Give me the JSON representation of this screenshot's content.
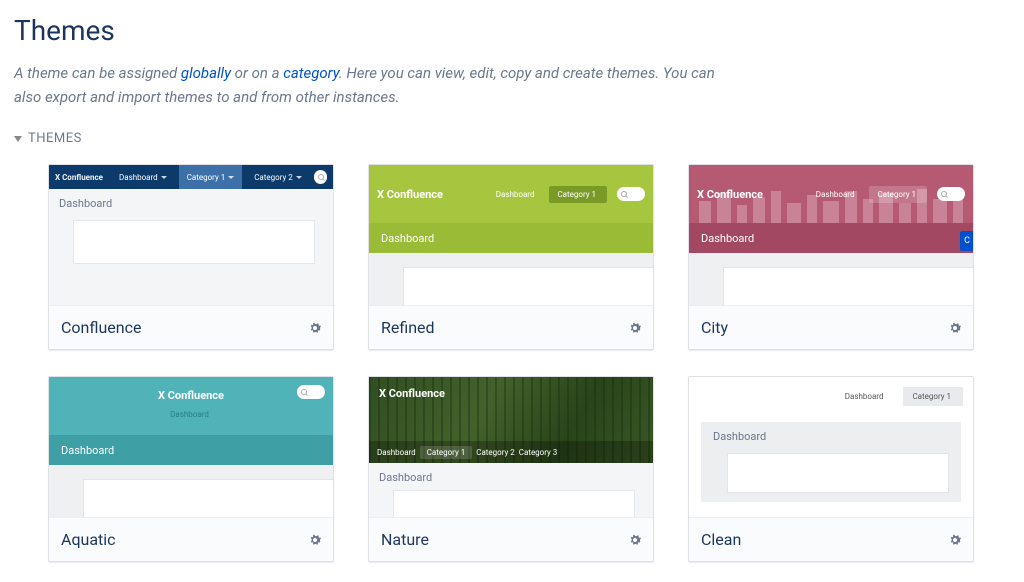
{
  "page_title": "Themes",
  "intro": {
    "pre": "A theme can be assigned ",
    "link1": "globally",
    "mid": " or on a ",
    "link2": "category",
    "post": ". Here you can view, edit, copy and create themes. You can also export and import themes to and from other instances."
  },
  "section_label": "THEMES",
  "brand": "X Confluence",
  "edge_label": "C",
  "themes": [
    {
      "name": "Confluence",
      "preview": {
        "topbar_bg": "#0b3a6b",
        "topbar_tabs": [
          {
            "label": "Dashboard",
            "bg": ""
          },
          {
            "label": "Category 1",
            "bg": "#3d6fa8"
          },
          {
            "label": "Category 2",
            "bg": ""
          }
        ],
        "dash_label": "Dashboard"
      }
    },
    {
      "name": "Refined",
      "preview": {
        "hero_bg": "#a6c63f",
        "dashbar_bg": "#99bb35",
        "hero_tabs": [
          {
            "label": "Dashboard",
            "bg": ""
          },
          {
            "label": "Category 1",
            "bg": "#7a9a28"
          }
        ],
        "dash_label": "Dashboard"
      }
    },
    {
      "name": "City",
      "preview": {
        "hero_bg": "#b65a73",
        "dashbar_bg": "#a34862",
        "hero_tabs": [
          {
            "label": "Dashboard",
            "bg": ""
          },
          {
            "label": "Category 1",
            "bg": "rgba(255,255,255,0.18)"
          }
        ],
        "dash_label": "Dashboard",
        "edge_btn": true
      }
    },
    {
      "name": "Aquatic",
      "preview": {
        "hero_bg": "#4fb3b8",
        "dashbar_bg": "#3e9fa4",
        "hero_tabs": [
          {
            "label": "Dashboard",
            "bg": ""
          }
        ],
        "dash_label": "Dashboard"
      }
    },
    {
      "name": "Nature",
      "preview": {
        "forest": true,
        "brand_only": true,
        "nav_tabs": [
          {
            "label": "Dashboard",
            "bg": ""
          },
          {
            "label": "Category 1",
            "bg": "rgba(255,255,255,0.15)"
          },
          {
            "label": "Category 2",
            "bg": ""
          },
          {
            "label": "Category 3",
            "bg": ""
          }
        ],
        "dash_label": "Dashboard"
      }
    },
    {
      "name": "Clean",
      "preview": {
        "clean_tabs": [
          {
            "label": "Dashboard",
            "active": false
          },
          {
            "label": "Category 1",
            "active": true
          }
        ],
        "dash_label": "Dashboard"
      }
    }
  ]
}
